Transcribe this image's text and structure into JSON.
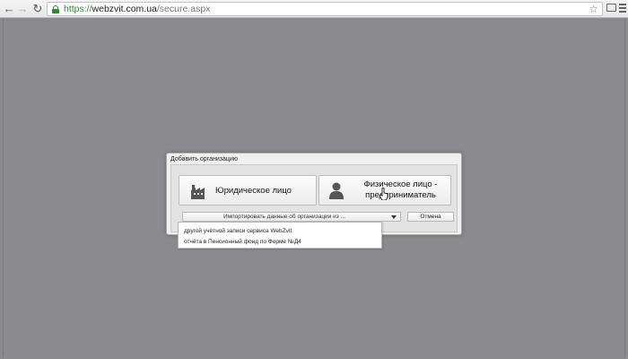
{
  "browser": {
    "url_scheme": "https://",
    "url_host": "webzvit.com.ua",
    "url_path": "/secure.aspx",
    "icons": [
      "back-arrow-icon",
      "forward-arrow-icon",
      "reload-icon",
      "lock-icon",
      "star-icon",
      "cast-icon",
      "menu-icon"
    ]
  },
  "dialog": {
    "title": "Добавить организацию",
    "legal_entity_label": "Юридическое лицо",
    "individual_line1": "Физическое лицо -",
    "individual_line2": "предприниматель",
    "import_select_label": "Импортировать данные об организации из ...",
    "cancel_label": "Отмена"
  },
  "dropdown": {
    "items": [
      "другой учётной записи сервиса WebZvit",
      "отчёта в Пенсионный фонд по Форме №Д4"
    ]
  },
  "colors": {
    "page_background": "#8b8a8f",
    "secure_green": "#2f8a2f"
  }
}
